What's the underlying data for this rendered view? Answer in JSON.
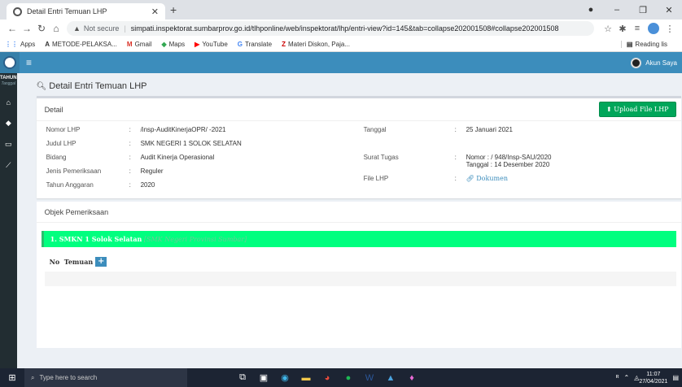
{
  "browser": {
    "tab_title": "Detail Entri Temuan LHP",
    "not_secure": "Not secure",
    "url": "simpati.inspektorat.sumbarprov.go.id/tlhponline/web/inspektorat/lhp/entri-view?id=145&tab=collapse202001508#collapse202001508",
    "bookmarks": [
      "Apps",
      "METODE-PELAKSA...",
      "Gmail",
      "Maps",
      "YouTube",
      "Translate",
      "Materi Diskon, Paja..."
    ],
    "reading_list": "Reading lis"
  },
  "header": {
    "account": "Akun Saya"
  },
  "sidebar": {
    "tahun": "TAHUN",
    "tanggal": "Tanggal"
  },
  "page": {
    "title": "Detail Entri Temuan LHP",
    "detail_title": "Detail",
    "upload_label": "Upload File LHP",
    "left": [
      {
        "key": "Nomor LHP",
        "val": "/insp-AuditKinerjaOPR/ -2021"
      },
      {
        "key": "Judul LHP",
        "val": "SMK NEGERI 1 SOLOK SELATAN"
      },
      {
        "key": "Bidang",
        "val": "Audit Kinerja Operasional"
      },
      {
        "key": "Jenis Pemeriksaan",
        "val": "Reguler"
      },
      {
        "key": "Tahun Anggaran",
        "val": "2020"
      }
    ],
    "right": {
      "tanggal_key": "Tanggal",
      "tanggal_val": "25 Januari 2021",
      "st_key": "Surat Tugas",
      "st_line1": "Nomor :   / 948/Insp-SAU/2020",
      "st_line2": "Tanggal : 14 Desember 2020",
      "file_key": "File LHP",
      "file_val": "Dokumen"
    },
    "objek_title": "Objek Pemeriksaan",
    "objek_item_num": "1. SMKN 1 Solok Selatan",
    "objek_item_sub": "[SMK Negeri Provinsi Sumbar]",
    "temuan_no": "No",
    "temuan_label": "Temuan"
  },
  "taskbar": {
    "search": "Type here to search",
    "time": "11:07",
    "date": "27/04/2021"
  },
  "colors": {
    "header": "#3c8dbc",
    "sidebar": "#222d32",
    "upload": "#00a65a",
    "objek_bar": "#00ff7f"
  }
}
